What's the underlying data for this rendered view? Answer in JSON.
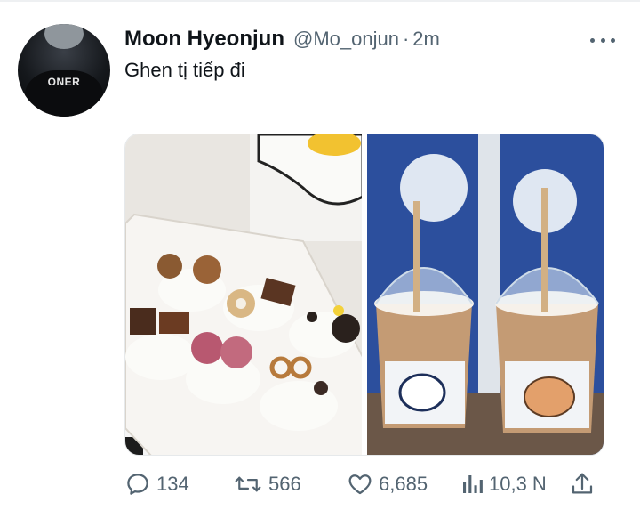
{
  "tweet": {
    "author_name": "Moon Hyeonjun",
    "handle": "@Mo_onjun",
    "separator": "·",
    "time": "2m",
    "text": "Ghen tị tiếp đi",
    "avatar_shirt_text": "ONER"
  },
  "media": {
    "photos": [
      {
        "subject": "box of mini cakes with cookies and chocolate"
      },
      {
        "subject": "two iced coffee drinks with puppy stickers"
      }
    ]
  },
  "actions": {
    "reply_count": "134",
    "retweet_count": "566",
    "like_count": "6,685",
    "views_count": "10,3 N"
  },
  "colors": {
    "text_primary": "#0f1419",
    "text_secondary": "#536471"
  }
}
